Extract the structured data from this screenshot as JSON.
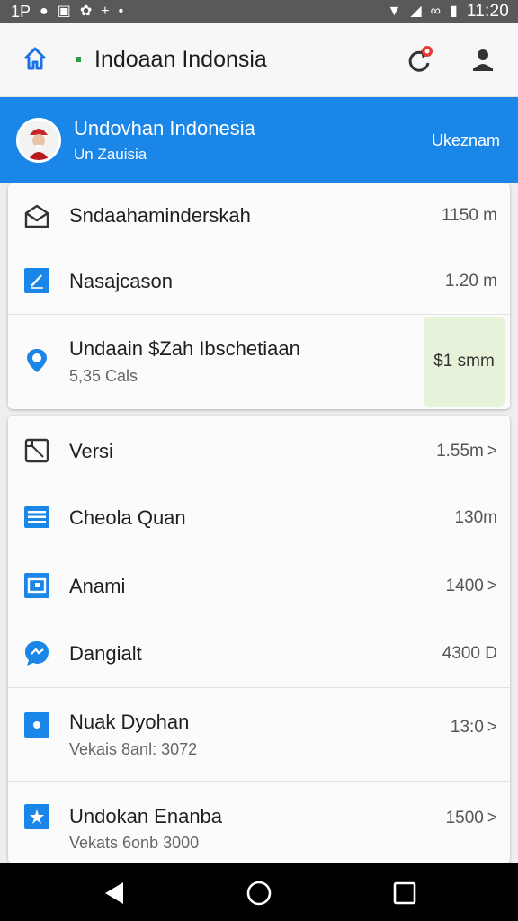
{
  "status_bar": {
    "left_text": "1P",
    "time": "11:20",
    "icons": [
      "wifi-icon",
      "signal-icon",
      "voicemail-icon",
      "battery-icon"
    ]
  },
  "app_bar": {
    "title": "Indoaan Indonsia",
    "icons": [
      "home-icon",
      "refresh-icon",
      "account-icon"
    ],
    "notification_color": "#e53935"
  },
  "banner": {
    "name": "Undovhan Indonesia",
    "subtitle": "Un Zauisia",
    "right_label": "Ukeznam",
    "color": "#1a86e8"
  },
  "card1": {
    "items": [
      {
        "label": "Sndaahaminderskah",
        "value": "1150 m",
        "icon": "envelope-icon"
      },
      {
        "label": "Nasajcason",
        "value": "1.20 m",
        "icon": "edit-square-icon"
      },
      {
        "label": "Undaain $Zah Ibschetiaan",
        "sub": "5,35 Cals",
        "value": "$1 smm",
        "icon": "location-pin-icon"
      }
    ]
  },
  "card2": {
    "items": [
      {
        "label": "Versi",
        "value": "1.55m",
        "chevron": ">",
        "icon": "crop-frame-icon"
      },
      {
        "label": "Cheola Quan",
        "value": "130m",
        "icon": "list-icon"
      },
      {
        "label": "Anami",
        "value": "1400",
        "chevron": ">",
        "icon": "screen-icon"
      },
      {
        "label": "Dangialt",
        "value": "4300 D",
        "icon": "chat-bubble-icon"
      },
      {
        "label": "Nuak Dyohan",
        "sub": "Vekais 8anl: 3072",
        "value": "13:0",
        "chevron": ">",
        "icon": "camera-icon"
      },
      {
        "label": "Undokan Enanba",
        "sub": "Vekats 6onb 3000",
        "value": "1500",
        "chevron": ">",
        "icon": "star-icon"
      }
    ]
  },
  "nav_bar": {
    "icons": [
      "back-icon",
      "home-circle-icon",
      "recents-icon"
    ]
  }
}
